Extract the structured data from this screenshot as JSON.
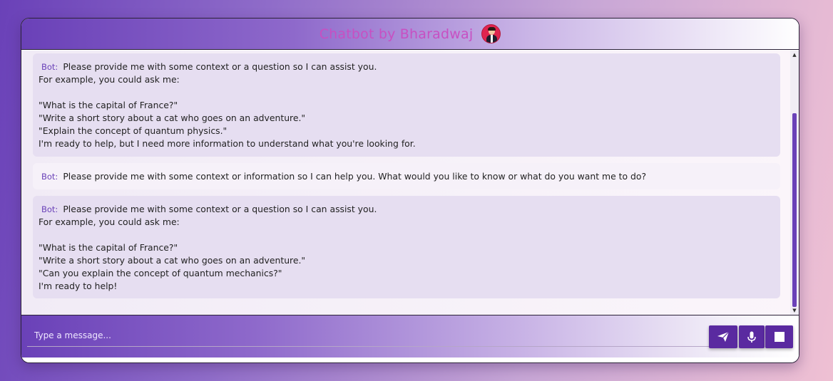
{
  "header": {
    "title": "Chatbot by Bharadwaj",
    "avatar_icon": "user-avatar-icon"
  },
  "messages": [
    {
      "sender": "Bot:",
      "lines": [
        "Please provide me with some context or a question so I can assist you.",
        "For example, you could ask me:",
        "",
        "\"What is the capital of France?\"",
        "\"Write a short story about a cat who goes on an adventure.\"",
        "\"Explain the concept of quantum physics.\"",
        "I'm ready to help, but I need more information to understand what you're looking for."
      ]
    },
    {
      "sender": "Bot:",
      "lines": [
        "Please provide me with some context or information so I can help you. What would you like to know or what do you want me to do?"
      ]
    },
    {
      "sender": "Bot:",
      "lines": [
        "Please provide me with some context or a question so I can assist you.",
        "For example, you could ask me:",
        "",
        "\"What is the capital of France?\"",
        "\"Write a short story about a cat who goes on an adventure.\"",
        "\"Can you explain the concept of quantum mechanics?\"",
        "I'm ready to help!"
      ]
    }
  ],
  "input": {
    "placeholder": "Type a message...",
    "value": ""
  },
  "buttons": {
    "send_icon": "send-icon",
    "mic_icon": "microphone-icon",
    "stop_icon": "stop-icon"
  },
  "colors": {
    "accent": "#6a41b8",
    "title": "#c84fc2",
    "button": "#5a2aa0"
  }
}
